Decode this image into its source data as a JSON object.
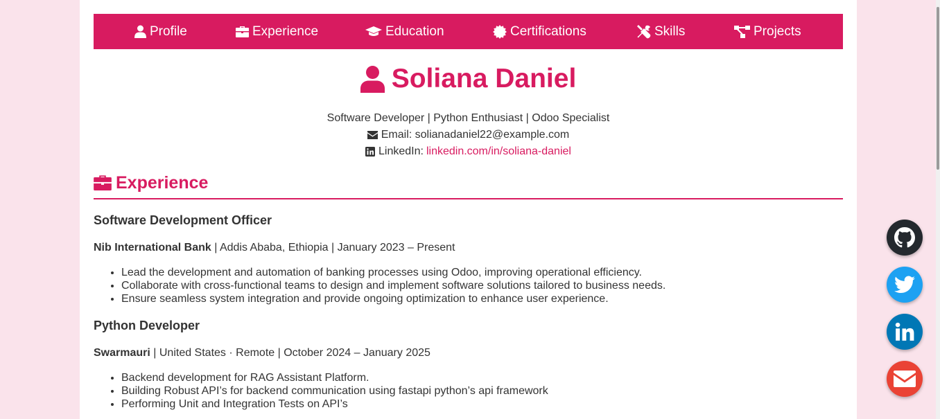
{
  "nav": {
    "items": [
      {
        "label": "Profile",
        "icon": "user-icon"
      },
      {
        "label": "Experience",
        "icon": "briefcase-icon"
      },
      {
        "label": "Education",
        "icon": "graduation-cap-icon"
      },
      {
        "label": "Certifications",
        "icon": "certificate-icon"
      },
      {
        "label": "Skills",
        "icon": "tools-icon"
      },
      {
        "label": "Projects",
        "icon": "project-diagram-icon"
      }
    ]
  },
  "header": {
    "name": "Soliana Daniel",
    "tagline": "Software Developer | Python Enthusiast | Odoo Specialist",
    "email_label": "Email: solianadaniel22@example.com",
    "linkedin_label": "LinkedIn:",
    "linkedin_link": "linkedin.com/in/soliana-daniel"
  },
  "experience": {
    "title": "Experience",
    "jobs": [
      {
        "title": "Software Development Officer",
        "company": "Nib International Bank",
        "details": " | Addis Ababa, Ethiopia | January 2023 – Present",
        "bullets": [
          "Lead the development and automation of banking processes using Odoo, improving operational efficiency.",
          "Collaborate with cross-functional teams to design and implement software solutions tailored to business needs.",
          "Ensure seamless system integration and provide ongoing optimization to enhance user experience."
        ]
      },
      {
        "title": "Python Developer",
        "company": "Swarmauri",
        "details": " | United States · Remote | October 2024 – January 2025",
        "bullets": [
          "Backend development for RAG Assistant Platform.",
          "Building Robust API’s for backend communication using fastapi python’s api framework",
          "Performing Unit and Integration Tests on API’s"
        ]
      }
    ]
  },
  "social": [
    {
      "name": "github",
      "color": "#24292e"
    },
    {
      "name": "twitter",
      "color": "#1da1f2"
    },
    {
      "name": "linkedin",
      "color": "#0077b5"
    },
    {
      "name": "email",
      "color": "#ea4335"
    }
  ],
  "colors": {
    "accent": "#d81b60",
    "page_bg": "#fae3eb"
  }
}
